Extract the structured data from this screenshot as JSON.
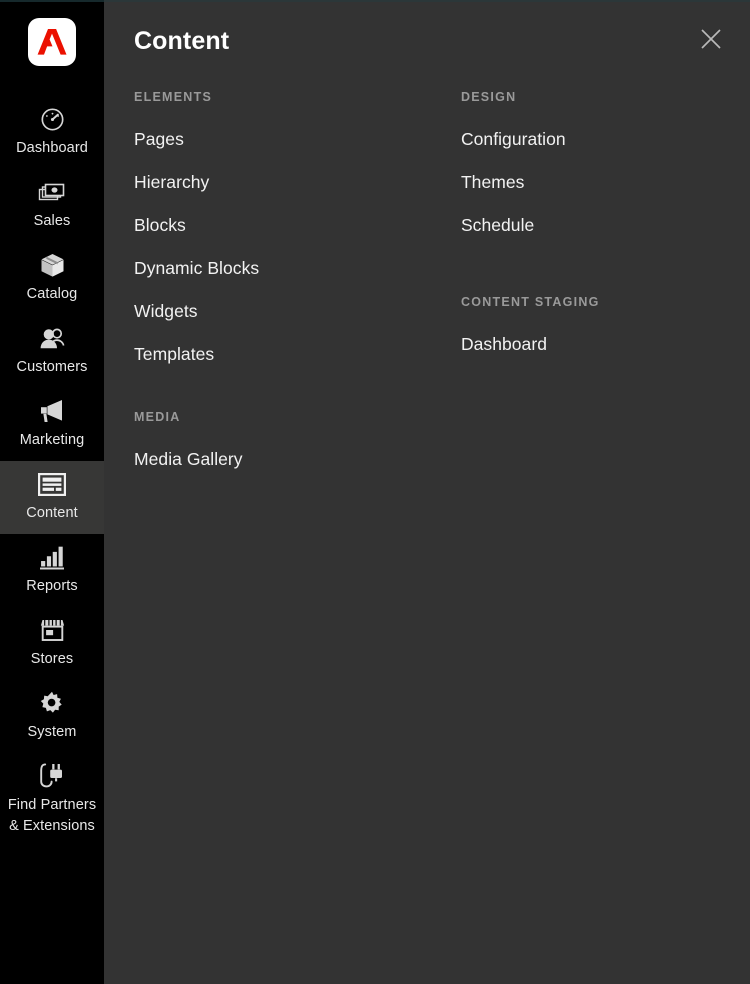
{
  "theme": {
    "sidebar_bg": "#000000",
    "panel_bg": "#333333",
    "active_item_bg": "#373736",
    "accent_red": "#eb1000",
    "label_gray": "#9a9a9a",
    "text_white": "#f2f2f2"
  },
  "sidebar": {
    "logo": {
      "icon": "adobe-logo-icon",
      "alt": "Adobe"
    },
    "items": [
      {
        "label": "Dashboard",
        "icon": "dashboard-gauge-icon",
        "active": false
      },
      {
        "label": "Sales",
        "icon": "money-stack-icon",
        "active": false
      },
      {
        "label": "Catalog",
        "icon": "box-package-icon",
        "active": false
      },
      {
        "label": "Customers",
        "icon": "people-group-icon",
        "active": false
      },
      {
        "label": "Marketing",
        "icon": "megaphone-icon",
        "active": false
      },
      {
        "label": "Content",
        "icon": "page-layout-icon",
        "active": true
      },
      {
        "label": "Reports",
        "icon": "bar-chart-icon",
        "active": false
      },
      {
        "label": "Stores",
        "icon": "storefront-icon",
        "active": false
      },
      {
        "label": "System",
        "icon": "gear-icon",
        "active": false
      },
      {
        "label": "Find Partners\n& Extensions",
        "icon": "power-plug-icon",
        "active": false
      }
    ]
  },
  "panel": {
    "title": "Content",
    "close_icon": "close-x-icon",
    "columns": [
      {
        "groups": [
          {
            "title": "ELEMENTS",
            "links": [
              "Pages",
              "Hierarchy",
              "Blocks",
              "Dynamic Blocks",
              "Widgets",
              "Templates"
            ]
          },
          {
            "title": "MEDIA",
            "links": [
              "Media Gallery"
            ]
          }
        ]
      },
      {
        "groups": [
          {
            "title": "DESIGN",
            "links": [
              "Configuration",
              "Themes",
              "Schedule"
            ]
          },
          {
            "title": "CONTENT STAGING",
            "links": [
              "Dashboard"
            ]
          }
        ]
      }
    ]
  }
}
